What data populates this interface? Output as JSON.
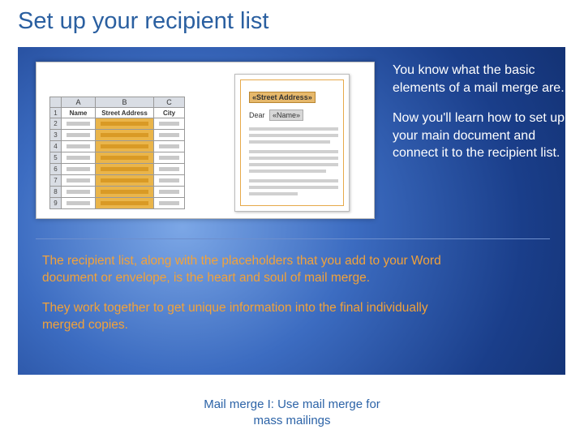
{
  "title": "Set up your recipient list",
  "spreadsheet": {
    "cols": [
      "A",
      "B",
      "C"
    ],
    "headers": [
      "Name",
      "Street Address",
      "City"
    ],
    "rowNums": [
      "1",
      "2",
      "3",
      "4",
      "5",
      "6",
      "7",
      "8",
      "9"
    ]
  },
  "document": {
    "streetField": "«Street Address»",
    "dear": "Dear",
    "nameField": "«Name»"
  },
  "side": {
    "p1": "You know what the basic elements of a mail merge are.",
    "p2": "Now you'll learn how to set up your main document and connect it to the recipient list."
  },
  "body": {
    "p1": "The recipient list, along with the placeholders that you add to your Word document or envelope, is the heart and soul of mail merge.",
    "p2": "They work together to get unique information into the final individually merged copies."
  },
  "footer": {
    "line1": "Mail merge I: Use mail merge for",
    "line2": "mass mailings"
  }
}
